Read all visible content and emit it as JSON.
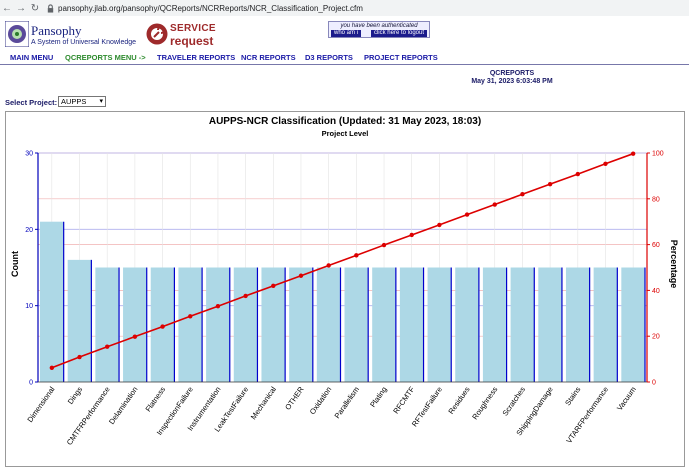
{
  "browser": {
    "url": "pansophy.jlab.org/pansophy/QCReports/NCRReports/NCR_Classification_Project.cfm",
    "back_glyph": "←",
    "forward_glyph": "→",
    "reload_glyph": "↻"
  },
  "header": {
    "logo_title": "Pansophy",
    "logo_subtitle": "A System of Universal Knowledge",
    "service_line1": "SERVICE",
    "service_line2": "request",
    "auth_text": "you have been authenticated",
    "who_am_i": "who am i",
    "logout": "click here to logout"
  },
  "menu": {
    "items": [
      {
        "label": "MAIN MENU",
        "active": false
      },
      {
        "label": "QCREPORTS MENU ->",
        "active": true
      },
      {
        "label": "TRAVELER REPORTS",
        "active": false
      },
      {
        "label": "NCR REPORTS",
        "active": false
      },
      {
        "label": "D3 REPORTS",
        "active": false
      },
      {
        "label": "PROJECT REPORTS",
        "active": false
      }
    ]
  },
  "report": {
    "title": "QCREPORTS",
    "timestamp": "May 31, 2023 6:03:48 PM"
  },
  "project_select": {
    "label": "Select Project:",
    "value": "AUPPS"
  },
  "colors": {
    "bar_fill": "#add8e6",
    "bar_edge": "#0000cc",
    "line": "#dd0000",
    "left_axis": "#0000bb",
    "right_axis": "#dd0000",
    "grid_blue": "#b0b0ee",
    "grid_red": "#f0b0b0"
  },
  "chart_data": {
    "type": "bar",
    "title": "AUPPS-NCR Classification (Updated: 31 May 2023, 18:03)",
    "subtitle": "Project Level",
    "ylabel": "Count",
    "y2label": "Percentage",
    "ylim": [
      0,
      30
    ],
    "y_ticks": [
      0,
      10,
      20,
      30
    ],
    "y2lim": [
      0,
      100
    ],
    "y2_ticks": [
      0,
      20,
      40,
      60,
      80,
      100
    ],
    "categories": [
      "Dimensional",
      "Dings",
      "CMTFRPerformance",
      "Delamination",
      "Flatness",
      "InspectionFailure",
      "Instrumentation",
      "LeakTestFailure",
      "Mechanical",
      "OTHER",
      "Oxidation",
      "Parallelism",
      "Plating",
      "RFCMTF",
      "RFTestFailure",
      "Residues",
      "Roughness",
      "Scratches",
      "ShippingDamage",
      "Stains",
      "VTARFPerformance",
      "Vacuum"
    ],
    "series": [
      {
        "type": "bar",
        "values": [
          21,
          16,
          15,
          15,
          15,
          15,
          15,
          15,
          15,
          15,
          15,
          15,
          15,
          15,
          15,
          15,
          15,
          15,
          15,
          15,
          15,
          15
        ]
      },
      {
        "type": "line",
        "values": [
          6.2,
          10.9,
          15.4,
          19.8,
          24.2,
          28.7,
          33.1,
          37.6,
          42.0,
          46.4,
          50.9,
          55.3,
          59.8,
          64.2,
          68.6,
          73.1,
          77.5,
          82.0,
          86.4,
          90.8,
          95.3,
          99.7
        ]
      }
    ],
    "grid": true,
    "legend": "none"
  }
}
